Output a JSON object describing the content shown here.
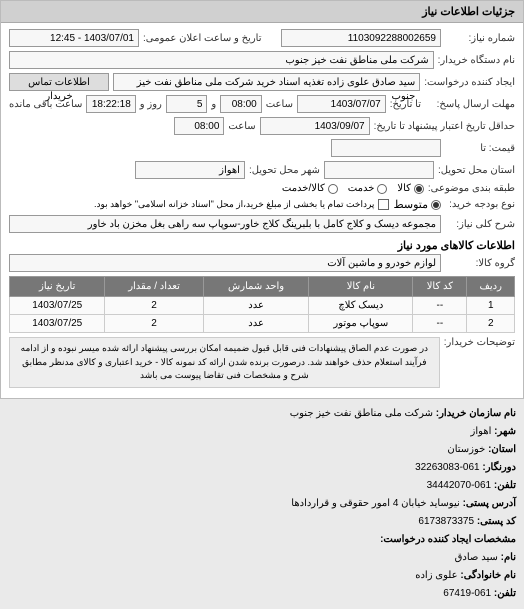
{
  "header": {
    "title": "جزئیات اطلاعات نیاز"
  },
  "fields": {
    "req_no_label": "شماره نیاز:",
    "req_no_value": "1103092288002659",
    "org_name_label": "نام دستگاه خریدار:",
    "org_name_value": "شرکت ملی مناطق نفت خیز جنوب",
    "creator_label": "ایجاد کننده درخواست:",
    "creator_value": "سید صادق علوی زاده  تغذیه اسناد خرید  شرکت ملی مناطق نفت خیز جنوب",
    "creator_btn": "اطلاعات تماس خریدار",
    "announce_label": "تاریخ و ساعت اعلان عمومی:",
    "announce_value": "1403/07/01 - 12:45",
    "deadline_label": "تا تاریخ:",
    "reply_deadline_label": "مهلت ارسال پاسخ:",
    "reply_date": "1403/07/07",
    "saat": "ساعت",
    "time1": "08:00",
    "remain_label": "و",
    "remain_days": "5",
    "remain_text": "روز و",
    "remain_time": "18:22:18",
    "remain_suffix": "ساعت باقی مانده",
    "validity_label": "حداقل تاریخ اعتبار پیشنهاد تا تاریخ:",
    "validity_date": "1403/09/07",
    "time2": "08:00",
    "price_label": "قیمت: تا",
    "price_value": "",
    "delivery_city_label": "شهر محل تحویل:",
    "delivery_city_value": "اهواز",
    "estan_label": "استان محل تحویل:",
    "estan_value": "",
    "budget_label": "طبقه بندی موضوعی:",
    "radio_goods": "کالا",
    "radio_service": "خدمت",
    "radio_both": "کالا/خدمت",
    "buy_type_label": "نوع بودجه خرید:",
    "buy_type_mid": "متوسط",
    "buy_type_text": "پرداخت تمام یا بخشی از مبلغ خرید،از محل \"اسناد خزانه اسلامی\" خواهد بود.",
    "desc_label": "شرح کلی نیاز:",
    "desc_value": "مجموعه دیسک و کلاج کامل با بلبرینگ کلاج خاور-سوپاپ سه راهی بغل مخزن باد خاور"
  },
  "items_section": {
    "title": "اطلاعات کالاهای مورد نیاز",
    "group_label": "گروه کالا:",
    "group_value": "لوازم خودرو و ماشین آلات"
  },
  "table": {
    "headers": [
      "ردیف",
      "کد کالا",
      "نام کالا",
      "واحد شمارش",
      "تعداد / مقدار",
      "تاریخ نیاز"
    ],
    "rows": [
      [
        "1",
        "--",
        "دیسک کلاچ",
        "عدد",
        "2",
        "1403/07/25"
      ],
      [
        "2",
        "--",
        "سوپاپ موتور",
        "عدد",
        "2",
        "1403/07/25"
      ]
    ]
  },
  "buyer_note": {
    "label": "توضیحات خریدار:",
    "text": "در صورت عدم الصاق پیشنهادات فنی قابل قبول ضمیمه امکان بررسی پیشنهاد ارائه شده میسر نبوده و از ادامه فرآیند استعلام حذف خواهند شد. درصورت برنده شدن ارائه کد نمونه کالا - خرید اعتباری و کالای مدنظر مطابق شرح و مشخصات فنی تقاضا پیوست می باشد"
  },
  "info": {
    "i1_l": "نام سازمان خریدار:",
    "i1_v": "شرکت ملی مناطق نفت خیز جنوب",
    "i2_l": "شهر:",
    "i2_v": "اهواز",
    "i3_l": "استان:",
    "i3_v": "خوزستان",
    "i4_l": "دورنگار:",
    "i4_v": "061-32263083",
    "i5_l": "تلفن:",
    "i5_v": "061-34442070",
    "i6_l": "آدرس پستی:",
    "i6_v": "نیوساید خیابان 4 امور حقوقی و قراردادها",
    "i7_l": "کد پستی:",
    "i7_v": "6173873375",
    "i8_l": "مشخصات ایجاد کننده درخواست:",
    "i9_l": "نام:",
    "i9_v": "سید صادق",
    "i10_l": "نام خانوادگی:",
    "i10_v": "علوی زاده",
    "i11_l": "تلفن:",
    "i11_v": "061-67419"
  }
}
